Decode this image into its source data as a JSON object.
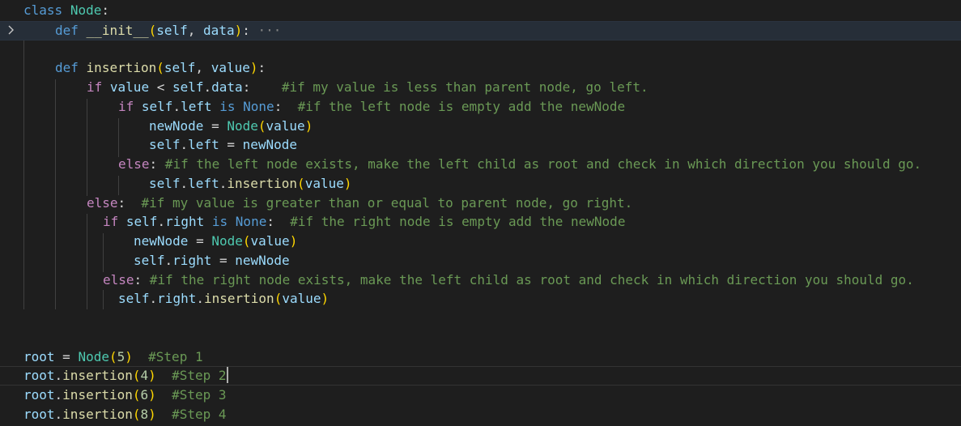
{
  "editor": {
    "language": "python",
    "colors": {
      "background": "#1e1e1e",
      "keyword": "#569cd6",
      "control": "#c586c0",
      "function": "#dcdcaa",
      "class": "#4ec9b0",
      "variable": "#9cdcfe",
      "number": "#b5cea8",
      "comment": "#6a9955",
      "bracket": "#ffd700",
      "bracket_inner": "#da70d6"
    },
    "fold_icon": "chevron-right-icon",
    "lines": {
      "l1": {
        "t1": "class",
        "t2": " ",
        "t3": "Node",
        "t4": ":"
      },
      "l2": {
        "t1": "def",
        "t2": " ",
        "t3": "__init__",
        "t4": "(",
        "t5": "self",
        "t6": ", ",
        "t7": "data",
        "t8": ")",
        "t9": ":",
        "t10": " ···"
      },
      "l4": {
        "t1": "def",
        "t2": " ",
        "t3": "insertion",
        "t4": "(",
        "t5": "self",
        "t6": ", ",
        "t7": "value",
        "t8": ")",
        "t9": ":"
      },
      "l5": {
        "t1": "if",
        "t2": " ",
        "t3": "value",
        "t4": " < ",
        "t5": "self",
        "t6": ".",
        "t7": "data",
        "t8": ":",
        "t9": "    #if my value is less than parent node, go left."
      },
      "l6": {
        "t1": "if",
        "t2": " ",
        "t3": "self",
        "t4": ".",
        "t5": "left",
        "t6": " ",
        "t7": "is",
        "t8": " ",
        "t9": "None",
        "t10": ":",
        "t11": "  #if the left node is empty add the newNode"
      },
      "l7": {
        "t1": "newNode",
        "t2": " = ",
        "t3": "Node",
        "t4": "(",
        "t5": "value",
        "t6": ")"
      },
      "l8": {
        "t1": "self",
        "t2": ".",
        "t3": "left",
        "t4": " = ",
        "t5": "newNode"
      },
      "l9": {
        "t1": "else",
        "t2": ":",
        "t3": " #if the left node exists, make the left child as root and check in which direction you should go."
      },
      "l10": {
        "t1": "self",
        "t2": ".",
        "t3": "left",
        "t4": ".",
        "t5": "insertion",
        "t6": "(",
        "t7": "value",
        "t8": ")"
      },
      "l11": {
        "t1": "else",
        "t2": ":",
        "t3": "  #if my value is greater than or equal to parent node, go right."
      },
      "l12": {
        "t1": "if",
        "t2": " ",
        "t3": "self",
        "t4": ".",
        "t5": "right",
        "t6": " ",
        "t7": "is",
        "t8": " ",
        "t9": "None",
        "t10": ":",
        "t11": "  #if the right node is empty add the newNode"
      },
      "l13": {
        "t1": "newNode",
        "t2": " = ",
        "t3": "Node",
        "t4": "(",
        "t5": "value",
        "t6": ")"
      },
      "l14": {
        "t1": "self",
        "t2": ".",
        "t3": "right",
        "t4": " = ",
        "t5": "newNode"
      },
      "l15": {
        "t1": "else",
        "t2": ":",
        "t3": " #if the right node exists, make the left child as root and check in which direction you should go."
      },
      "l16": {
        "t1": "self",
        "t2": ".",
        "t3": "right",
        "t4": ".",
        "t5": "insertion",
        "t6": "(",
        "t7": "value",
        "t8": ")"
      },
      "l19": {
        "t1": "root",
        "t2": " = ",
        "t3": "Node",
        "t4": "(",
        "t5": "5",
        "t6": ")",
        "t7": "  #Step 1"
      },
      "l20": {
        "t1": "root",
        "t2": ".",
        "t3": "insertion",
        "t4": "(",
        "t5": "4",
        "t6": ")",
        "t7": "  #Step 2"
      },
      "l21": {
        "t1": "root",
        "t2": ".",
        "t3": "insertion",
        "t4": "(",
        "t5": "6",
        "t6": ")",
        "t7": "  #Step 3"
      },
      "l22": {
        "t1": "root",
        "t2": ".",
        "t3": "insertion",
        "t4": "(",
        "t5": "8",
        "t6": ")",
        "t7": "  #Step 4"
      }
    }
  }
}
